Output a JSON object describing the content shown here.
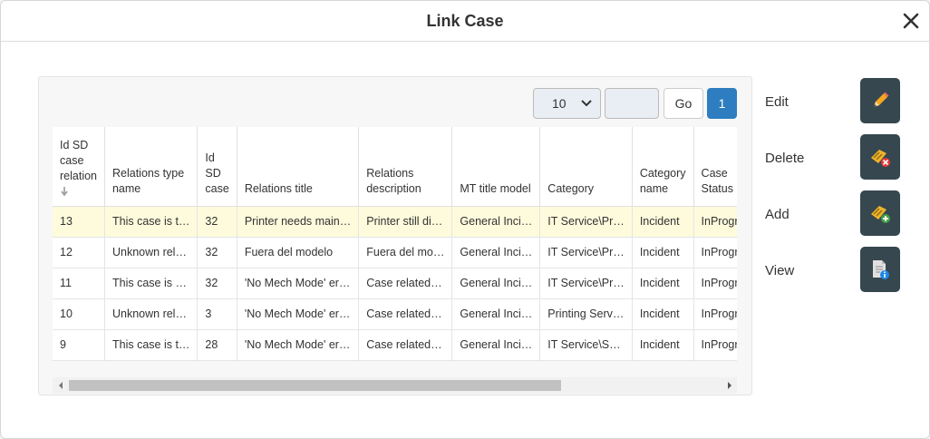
{
  "dialog": {
    "title": "Link Case"
  },
  "pager": {
    "page_size": "10",
    "jump_value": "",
    "go_label": "Go",
    "current_page": "1"
  },
  "table": {
    "columns": [
      "Id SD case relation",
      "Relations type name",
      "Id SD case",
      "Relations title",
      "Relations description",
      "MT title model",
      "Category",
      "Category name",
      "Case Status"
    ],
    "rows": [
      [
        "13",
        "This case is t…",
        "32",
        "Printer needs main…",
        "Printer still di…",
        "General Inci…",
        "IT Service\\Pr…",
        "Incident",
        "InProgr"
      ],
      [
        "12",
        "Unknown rel…",
        "32",
        "Fuera del modelo",
        "Fuera del mo…",
        "General Inci…",
        "IT Service\\Pr…",
        "Incident",
        "InProgr"
      ],
      [
        "11",
        "This case is …",
        "32",
        "'No Mech Mode' er…",
        "Case related…",
        "General Inci…",
        "IT Service\\Pr…",
        "Incident",
        "InProgr"
      ],
      [
        "10",
        "Unknown rel…",
        "3",
        "'No Mech Mode' er…",
        "Case related…",
        "General Inci…",
        "Printing Serv…",
        "Incident",
        "InProgr"
      ],
      [
        "9",
        "This case is t…",
        "28",
        "'No Mech Mode' er…",
        "Case related…",
        "General Inci…",
        "IT Service\\S…",
        "Incident",
        "InProgr"
      ]
    ],
    "selected_row": 0
  },
  "actions": {
    "edit": "Edit",
    "delete": "Delete",
    "add": "Add",
    "view": "View"
  },
  "colors": {
    "accent": "#2e7dc0",
    "action_bg": "#37474f",
    "selected_row": "#fdfbdc"
  }
}
